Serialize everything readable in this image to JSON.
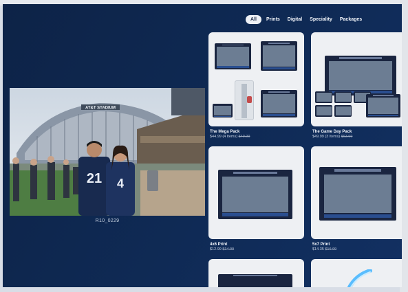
{
  "filters": {
    "tabs": [
      {
        "label": "All"
      },
      {
        "label": "Prints"
      },
      {
        "label": "Digital"
      },
      {
        "label": "Speciality"
      },
      {
        "label": "Packages"
      }
    ],
    "active": "All"
  },
  "photo": {
    "caption": "R10_0229",
    "stadium_sign": "AT&T STADIUM"
  },
  "products": [
    {
      "title": "The Mega Pack",
      "price": "$44.99 (4 Items)",
      "original_price": "$49.99"
    },
    {
      "title": "The Game Day Pack",
      "price": "$49.99 (3 Items)",
      "original_price": "$63.99"
    },
    {
      "title": "4x6 Print",
      "price": "$12.99",
      "original_price": "$14.99"
    },
    {
      "title": "5x7 Print",
      "price": "$14.35",
      "original_price": "$16.99"
    }
  ],
  "colors": {
    "background": "#0f2a55",
    "card": "#eef0f3",
    "print_band": "#2a4e8f"
  }
}
